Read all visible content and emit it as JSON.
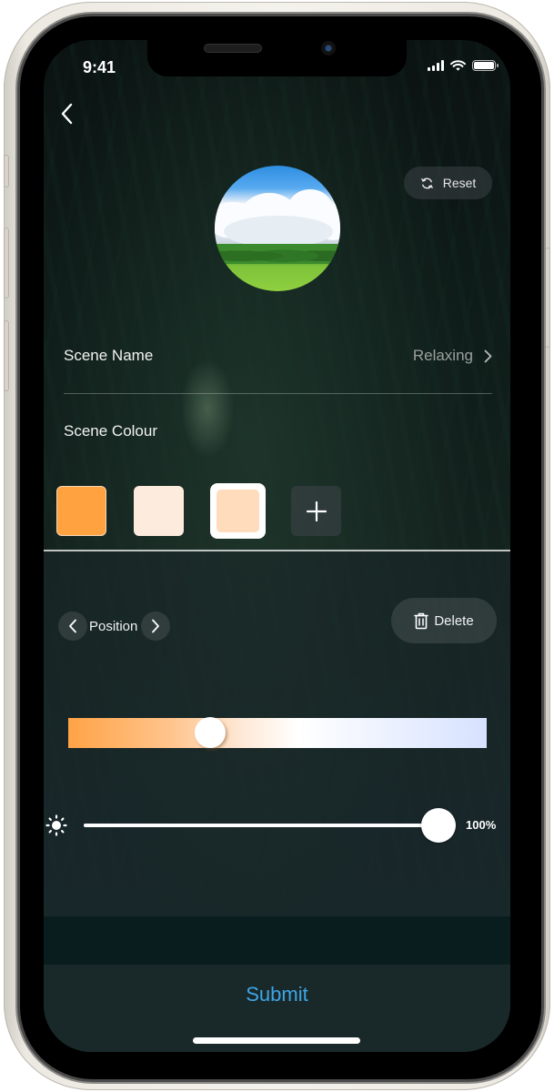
{
  "status_bar": {
    "time": "9:41",
    "icons": [
      "cellular-signal-icon",
      "wifi-icon",
      "battery-icon"
    ]
  },
  "nav": {
    "back_icon": "chevron-left-icon"
  },
  "header": {
    "scene_image": "blue-sky-green-field-photo",
    "reset_label": "Reset",
    "reset_icon": "refresh-icon"
  },
  "scene_name": {
    "label": "Scene Name",
    "value": "Relaxing",
    "chevron_icon": "chevron-right-icon"
  },
  "scene_colour": {
    "label": "Scene Colour",
    "swatches": [
      {
        "color": "#FFA23F",
        "selected": false
      },
      {
        "color": "#FDEBDD",
        "selected": false
      },
      {
        "color": "#FFDCBB",
        "selected": true
      }
    ],
    "add_icon": "plus-icon"
  },
  "position": {
    "label": "Position",
    "prev_icon": "chevron-left-icon",
    "next_icon": "chevron-right-icon"
  },
  "delete": {
    "label": "Delete",
    "icon": "trash-icon"
  },
  "colour_temperature": {
    "value_fraction": 0.34,
    "gradient_start": "#FFA346",
    "gradient_end": "#D6E2FF"
  },
  "brightness": {
    "icon": "sun-icon",
    "value_percent": 100,
    "value_label": "100%"
  },
  "footer": {
    "submit_label": "Submit",
    "submit_color": "#3EA6E8"
  }
}
